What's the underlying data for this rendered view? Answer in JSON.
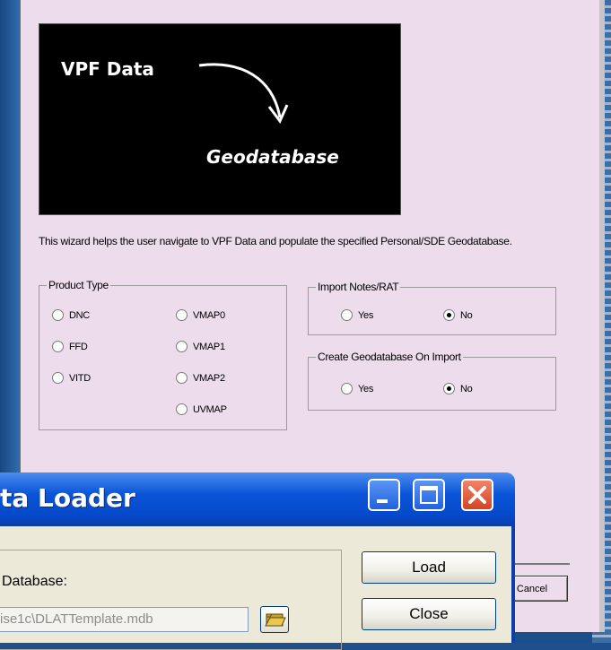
{
  "wizard": {
    "banner": {
      "from_text": "VPF Data",
      "to_text": "Geodatabase"
    },
    "description": "This wizard helps the user navigate to VPF Data and populate the specified Personal/SDE Geodatabase.",
    "product_type": {
      "label": "Product Type",
      "options": [
        "DNC",
        "FFD",
        "VITD",
        "VMAP0",
        "VMAP1",
        "VMAP2",
        "UVMAP"
      ]
    },
    "import_notes": {
      "label": "Import Notes/RAT",
      "yes": "Yes",
      "no": "No",
      "selected": "No"
    },
    "create_gdb": {
      "label": "Create Geodatabase On Import",
      "yes": "Yes",
      "no": "No",
      "selected": "No"
    },
    "cancel_label": "Cancel"
  },
  "dialog": {
    "title": "ta Loader",
    "database_label": "Database:",
    "database_value": "ise1c\\DLATTemplate.mdb",
    "load_label": "Load",
    "close_label": "Close"
  },
  "colors": {
    "wizard_bg": "#ecdcec",
    "xp_title_blue": "#0a54d8",
    "xp_close_red": "#d24322",
    "desktop_blue": "#2a64a8"
  }
}
